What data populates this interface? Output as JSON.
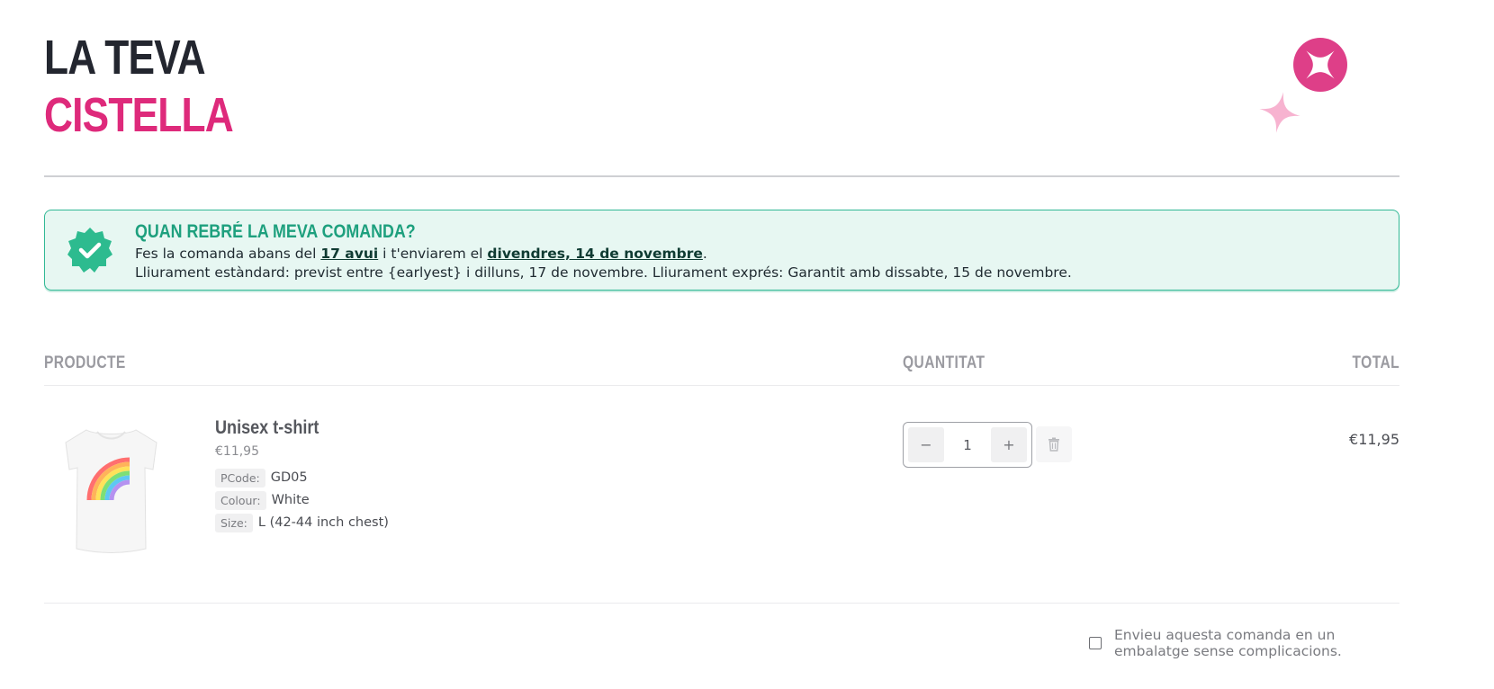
{
  "header": {
    "title_line1": "LA TEVA",
    "title_line2": "CISTELLA",
    "accent_color": "#de2a7b"
  },
  "delivery": {
    "heading": "QUAN REBRÉ LA MEVA COMANDA?",
    "line1_pre": "Fes la comanda abans del ",
    "line1_cutoff": "17 avui",
    "line1_mid": " i t'enviarem el ",
    "line1_ship_date": "divendres, 14 de novembre",
    "line1_post": ".",
    "line2": "Lliurament estàndard: previst entre {earlyest} i dilluns, 17 de novembre. Lliurament exprés: Garantit amb dissabte, 15 de novembre.",
    "icon": "verified-check-badge-icon",
    "color": "#31b895"
  },
  "table": {
    "col_product": "PRODUCTE",
    "col_quantity": "QUANTITAT",
    "col_total": "TOTAL"
  },
  "items": [
    {
      "name": "Unisex t-shirt",
      "price": "€11,95",
      "attributes": [
        {
          "key": "PCode:",
          "value": "GD05"
        },
        {
          "key": "Colour:",
          "value": "White"
        },
        {
          "key": "Size:",
          "value": "L (42-44 inch chest)"
        }
      ],
      "quantity": "1",
      "minus_label": "−",
      "plus_label": "+",
      "line_total": "€11,95",
      "image": "white-tshirt-rainbow-print"
    }
  ],
  "eco_option": {
    "label": "Envieu aquesta comanda en un embalatge sense complicacions.",
    "checked": false
  }
}
